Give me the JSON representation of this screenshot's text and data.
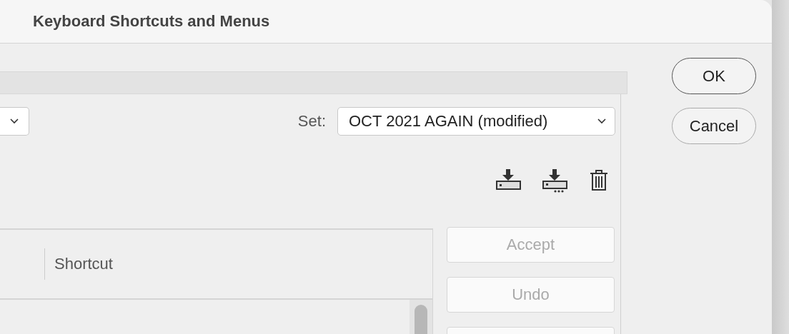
{
  "window": {
    "title": "Keyboard Shortcuts and Menus"
  },
  "set": {
    "label": "Set:",
    "value": "OCT 2021 AGAIN (modified)"
  },
  "table": {
    "columns": [
      {
        "label": "Shortcut"
      }
    ]
  },
  "side_buttons": [
    {
      "label": "Accept",
      "disabled": true
    },
    {
      "label": "Undo",
      "disabled": true
    }
  ],
  "dialog_buttons": [
    {
      "label": "OK",
      "kind": "default"
    },
    {
      "label": "Cancel",
      "kind": "normal"
    }
  ]
}
